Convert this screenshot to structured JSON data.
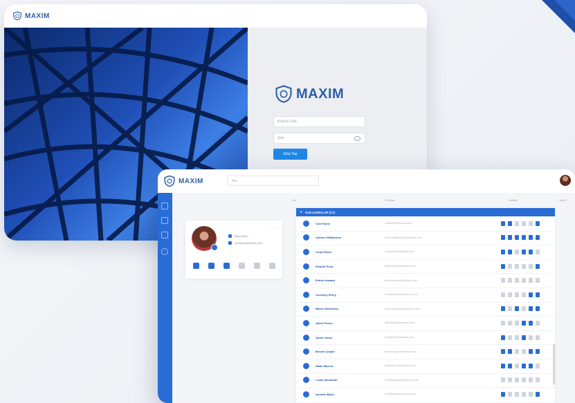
{
  "brand": {
    "name": "MAXIM"
  },
  "login": {
    "username_placeholder": "Kullanıcı Adı",
    "password_placeholder": "Şifre",
    "submit_label": "Giriş Yap"
  },
  "app": {
    "search_placeholder": "Ara",
    "columns": [
      "Ad",
      "E-Posta",
      "Yetkiler",
      "İşlem"
    ],
    "profile": {
      "menu_glyph": "···",
      "name": "Mesut Alev",
      "email": "ornekmail@ornek.com"
    },
    "list_title": "KULLANICILAR (17)",
    "users": [
      {
        "name": "Cole Stone",
        "email": "colestone@example.com",
        "perms": [
          1,
          1,
          0,
          0,
          0,
          1
        ]
      },
      {
        "name": "Carmen Williamson",
        "email": "carmenwilliamson@example.com",
        "perms": [
          1,
          1,
          1,
          1,
          1,
          1
        ]
      },
      {
        "name": "Cody Peters",
        "email": "codypeters@example.com",
        "perms": [
          1,
          1,
          0,
          1,
          1,
          0
        ]
      },
      {
        "name": "Eleanor Pena",
        "email": "eleanorpena@example.com",
        "perms": [
          1,
          0,
          0,
          0,
          0,
          1
        ]
      },
      {
        "name": "Esther Howard",
        "email": "estherhoward@example.com",
        "perms": [
          0,
          0,
          0,
          0,
          0,
          0
        ]
      },
      {
        "name": "Courtney Henry",
        "email": "courtneyhenry@example.com",
        "perms": [
          0,
          0,
          0,
          0,
          1,
          1
        ]
      },
      {
        "name": "Marvin McKinney",
        "email": "marvinmckinney@example.com",
        "perms": [
          1,
          0,
          1,
          0,
          1,
          1
        ]
      },
      {
        "name": "Albert Flores",
        "email": "albertflores@example.com",
        "perms": [
          0,
          0,
          0,
          1,
          1,
          0
        ]
      },
      {
        "name": "Jacob Jones",
        "email": "jacobjones@example.com",
        "perms": [
          1,
          0,
          0,
          1,
          0,
          0
        ]
      },
      {
        "name": "Bessie Cooper",
        "email": "bessiecooper@example.com",
        "perms": [
          1,
          1,
          0,
          0,
          1,
          1
        ]
      },
      {
        "name": "Wade Warren",
        "email": "wadewarren@example.com",
        "perms": [
          1,
          1,
          0,
          1,
          1,
          0
        ]
      },
      {
        "name": "Leslie Alexander",
        "email": "lesliealexander@example.com",
        "perms": [
          0,
          0,
          0,
          0,
          0,
          0
        ]
      },
      {
        "name": "Annette Black",
        "email": "annetteblack@example.com",
        "perms": [
          1,
          0,
          0,
          0,
          0,
          1
        ]
      }
    ]
  },
  "icons": {
    "brand": "shield-logo-icon",
    "sidebar": [
      "dashboard-icon",
      "folder-icon",
      "document-icon",
      "settings-icon"
    ],
    "profile_actions": [
      "user-icon",
      "document-icon",
      "search-icon",
      "list-icon",
      "calendar-icon",
      "contact-icon"
    ]
  },
  "colors": {
    "primary": "#2a6cd6",
    "brand": "#2c5fa8",
    "action_off": "#cfd4dd"
  }
}
